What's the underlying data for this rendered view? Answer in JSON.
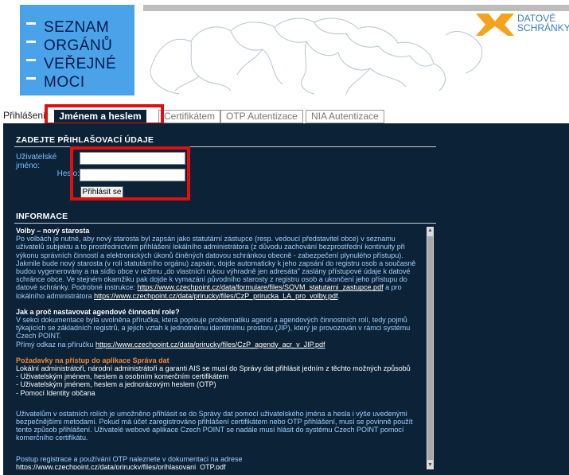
{
  "header": {
    "logo_lines": [
      "SEZNAM",
      "ORGÁNŮ",
      "VEŘEJNÉ",
      "MOCI"
    ],
    "ds_line1": "DATOVÉ",
    "ds_line2": "SCHRÁNKY"
  },
  "tabs": {
    "label": "Přihlášení:",
    "items": [
      {
        "label": "Jménem a heslem",
        "active": true
      },
      {
        "label": "Certifikátem",
        "active": false
      },
      {
        "label": "OTP Autentizace",
        "active": false
      },
      {
        "label": "NIA Autentizace",
        "active": false
      }
    ]
  },
  "login": {
    "title": "ZADEJTE PŘIHLAŠOVACÍ ÚDAJE",
    "username_label": "Uživatelské jméno:",
    "username_value": "",
    "password_label": "Heslo:",
    "password_value": "",
    "submit_label": "Přihlásit se"
  },
  "info": {
    "title": "INFORMACE",
    "s1_heading": "Volby – nový starosta",
    "s1_text": "Po volbách je nutné, aby nový starosta byl zapsán jako statutární zástupce (resp. vedoucí představitel obce) v seznamu uživatelů subjektu a to prostřednictvím přihlášení lokálního administrátora (z důvodu zachování bezprostřední kontinuity při výkonu správních činností a elektronických úkonů činěných datovou schránkou obecně - zabezpečení plynulého přístupu). Jakmile bude nový starosta (v roli statutárního orgánu) zapsán, dojde automaticky k jeho zapsání do registru osob a současně budou vygenerovány a na sídlo obce v režimu „do vlastních rukou výhradně jen adresáta\" zaslány přístupové údaje k datové schránce obce. Ve stejném okamžiku pak dojde k vymazání původního starosty z registru osob a ukončení jeho přístupu do datové schránky. Podrobné instrukce: ",
    "s1_link1": "https://www.czechpoint.cz/data/formulare/files/SOVM_statutarni_zastupce.pdf",
    "s1_mid": " a pro lokálního administrátora ",
    "s1_link2": "https://www.czechpoint.cz/data/prirucky/files/CzP_prirucka_LA_pro_volby.pdf",
    "s1_end": ".",
    "s2_heading": "Jak a proč nastavovat agendové činnostní role?",
    "s2_text": "V sekci dokumentace byla uvolněna příručka, která popisuje problematiku agend a agendových činnostních rolí, tedy pojmů týkajících se základních registrů, a jejich vztah k jednotnému identitnímu prostoru (JIP), který je provozován v rámci systému Czech POINT.",
    "s2_text2": "Přímý odkaz na příručku ",
    "s2_link": "https://www.czechpoint.cz/data/prirucky/files/CzP_agendy_acr_v_JIP.pdf",
    "s3_heading": "Požadavky na přístup do aplikace Správa dat",
    "s3_intro": "Lokální administrátoři, národní administrátoři a garanti AIS se musí do Správy dat přihlásit jedním z těchto možných způsobů",
    "s3_items": [
      " - Uživatelským jménem, heslem a osobním komerčním certifikátem",
      " - Uživatelským jménem, heslem a jednorázovým heslem (OTP)",
      " - Pomocí Identity občana"
    ],
    "s4_text": "Uživatelům v ostatních rolích je umožněno přihlásit se do Správy dat pomocí uživatelského jména a hesla i výše uvedenými bezpečnějšími metodami. Pokud má účet zaregistrováno přihlášení certifikátem nebo OTP přihlášení, musí se povinně použít tento způsob přihlášení. Uživatelé webové aplikace Czech POINT se nadále musí hlásit do systému Czech POINT pomocí komerčního certifikátu.",
    "s5_text": "Postup registrace a používání OTP naleznete v dokumentaci na adrese",
    "s5_link": "https://www.czechpoint.cz/data/prirucky/files/prihlasovani_OTP.pdf"
  },
  "colors": {
    "panel_bg": "#0b2237",
    "logo_bg": "#4aa3e8",
    "highlight": "#e01010",
    "label_blue": "#7fbfff",
    "orange_heading": "#f08a3a"
  }
}
